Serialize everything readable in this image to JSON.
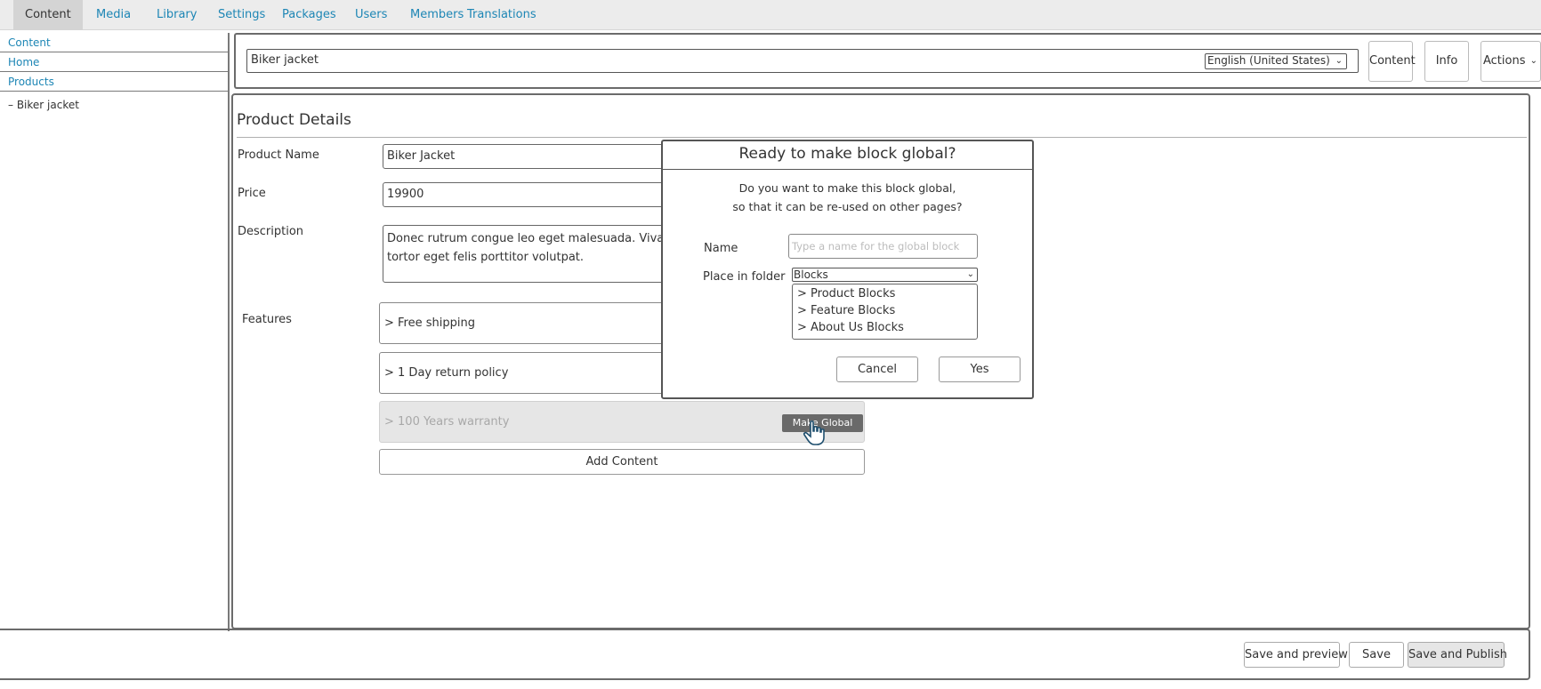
{
  "nav": {
    "items": [
      "Content",
      "Media",
      "Library",
      "Settings",
      "Packages",
      "Users",
      "Members",
      "Translations"
    ],
    "active": "Content"
  },
  "tree": {
    "items": [
      "Content",
      "Home",
      "Products"
    ],
    "leaf": "– Biker jacket"
  },
  "header": {
    "node_name": "Biker jacket",
    "language": "English (United States)",
    "buttons": {
      "content": "Content",
      "info": "Info",
      "actions": "Actions"
    }
  },
  "form": {
    "section_title": "Product Details",
    "fields": {
      "product_name": {
        "label": "Product Name",
        "value": "Biker Jacket"
      },
      "price": {
        "label": "Price",
        "value": "19900"
      },
      "description": {
        "label": "Description",
        "value": "Donec rutrum congue leo eget malesuada. Vivamus suscipit tortor eget felis porttitor volutpat."
      }
    },
    "features_label": "Features",
    "features": [
      "> Free shipping",
      "> 1 Day return policy",
      "> 100 Years warranty"
    ],
    "make_global_label": "Make Global",
    "add_content_label": "Add Content"
  },
  "dialog": {
    "title": "Ready to make block global?",
    "message_line1": "Do you want to make this block global,",
    "message_line2": "so that it can be re-used on other pages?",
    "name_label": "Name",
    "name_placeholder": "Type a name for the global block",
    "folder_label": "Place in folder",
    "folder_selected": "Blocks",
    "folders": [
      "> Product Blocks",
      "> Feature Blocks",
      "> About Us Blocks"
    ],
    "cancel_label": "Cancel",
    "yes_label": "Yes"
  },
  "footer": {
    "save_preview_label": "Save and preview",
    "save_label": "Save",
    "save_publish_label": "Save and Publish"
  },
  "colors": {
    "link": "#1d86b5",
    "border": "#6b6b6b",
    "button_dark": "#6a6a6a",
    "nav_bg": "#ececec",
    "nav_active_bg": "#d4d4d4"
  },
  "icons": {
    "chevron": "chevron-down-icon",
    "pointer": "hand-pointer-icon"
  }
}
